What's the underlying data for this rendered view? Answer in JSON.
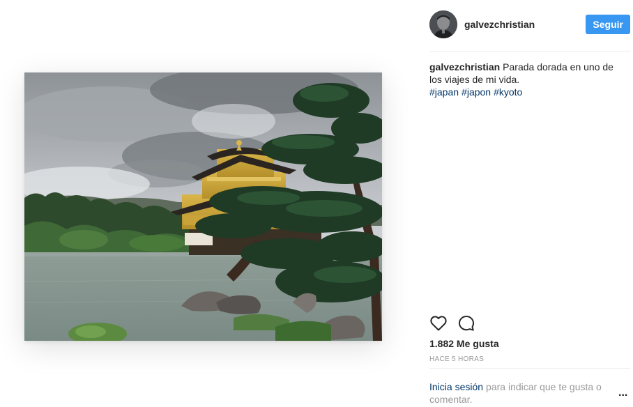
{
  "post": {
    "image_alt": "Pabellón dorado rodeado de pinos junto a un estanque",
    "author": "galvezchristian",
    "follow_label": "Seguir",
    "caption_text": "Parada dorada en uno de los viajes de mi vida.",
    "hashtags": [
      "#japan",
      "#japon",
      "#kyoto"
    ],
    "likes_text": "1.882 Me gusta",
    "time_text": "HACE 5 HORAS",
    "login_link": "Inicia sesión",
    "login_text": "para indicar que te gusta o comentar.",
    "more_label": "..."
  },
  "icons": {
    "avatar": "avatar",
    "like": "heart-icon",
    "comment": "comment-icon",
    "more": "more-options-icon"
  },
  "colors": {
    "follow_button": "#3897f0",
    "link": "#003569",
    "muted": "#999999",
    "text": "#262626"
  }
}
